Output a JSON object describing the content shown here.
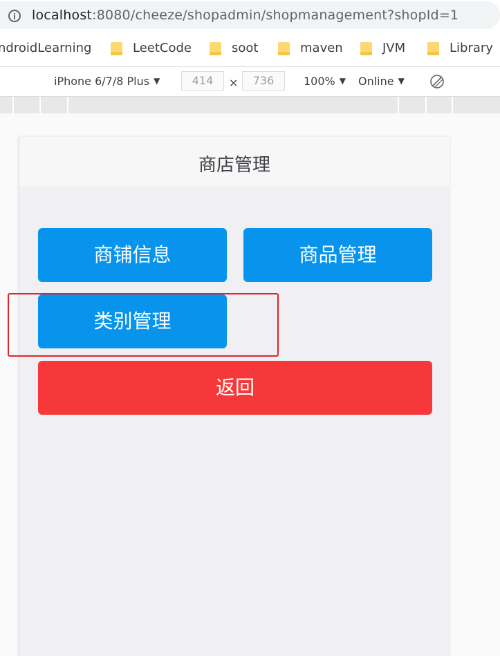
{
  "browser": {
    "url_host": "localhost",
    "url_rest": ":8080/cheeze/shopadmin/shopmanagement?shopId=1"
  },
  "bookmarks": [
    {
      "label": "ndroidLearning",
      "folder": false
    },
    {
      "label": "LeetCode",
      "folder": true
    },
    {
      "label": "soot",
      "folder": true
    },
    {
      "label": "maven",
      "folder": true
    },
    {
      "label": "JVM",
      "folder": true
    },
    {
      "label": "Library",
      "folder": true
    }
  ],
  "devtools": {
    "device": "iPhone 6/7/8 Plus",
    "width": "414",
    "height": "736",
    "times": "×",
    "zoom": "100%",
    "network": "Online"
  },
  "app": {
    "title": "商店管理",
    "buttons": {
      "shop_info": "商铺信息",
      "product_manage": "商品管理",
      "category_manage": "类别管理",
      "back": "返回"
    }
  },
  "colors": {
    "primary_button": "#0894ec",
    "danger_button": "#f6383a",
    "highlight_border": "#e0232a"
  }
}
